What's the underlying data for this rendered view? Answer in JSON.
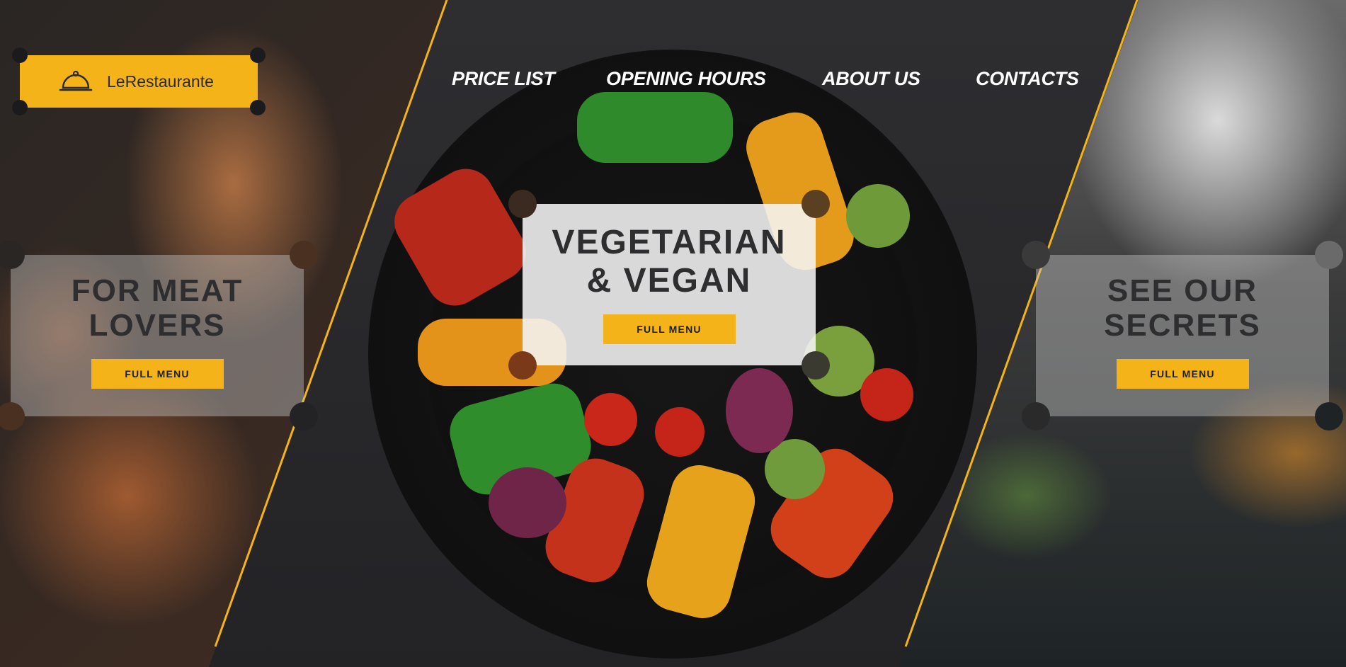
{
  "brand": {
    "logo_text": "LeRestaurante",
    "accent_color": "#f3b319",
    "icon": "serving-cloche-icon"
  },
  "nav": {
    "items": [
      {
        "label": "PRICE LIST"
      },
      {
        "label": "OPENING HOURS"
      },
      {
        "label": "ABOUT US"
      },
      {
        "label": "CONTACTS"
      }
    ]
  },
  "panels": [
    {
      "title_line1": "FOR MEAT",
      "title_line2": "LOVERS",
      "button_label": "FULL MENU"
    },
    {
      "title_line1": "VEGETARIAN",
      "title_line2": "& VEGAN",
      "button_label": "FULL MENU"
    },
    {
      "title_line1": "SEE OUR",
      "title_line2": "SECRETS",
      "button_label": "FULL MENU"
    }
  ]
}
